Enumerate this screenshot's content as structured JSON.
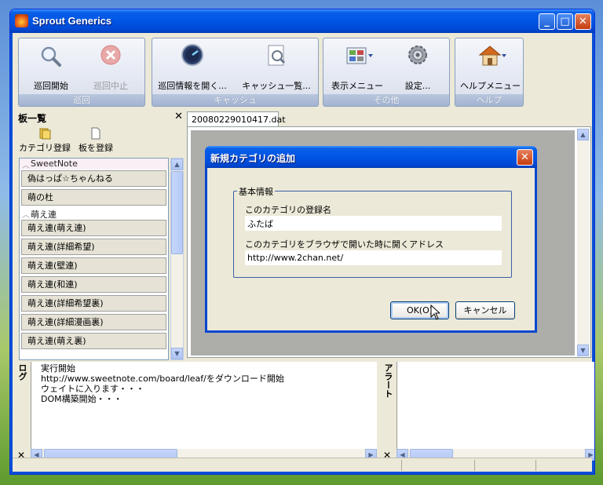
{
  "window": {
    "title": "Sprout Generics"
  },
  "ribbon": {
    "groups": [
      {
        "label": "巡回",
        "buttons": [
          {
            "label": "巡回開始",
            "icon": "magnifier-icon",
            "enabled": true
          },
          {
            "label": "巡回中止",
            "icon": "stop-icon",
            "enabled": false
          }
        ]
      },
      {
        "label": "キャッシュ",
        "buttons": [
          {
            "label": "巡回情報を開く...",
            "icon": "clock-icon"
          },
          {
            "label": "キャッシュ一覧...",
            "icon": "document-search-icon"
          }
        ]
      },
      {
        "label": "その他",
        "buttons": [
          {
            "label": "表示メニュー",
            "icon": "grid-icon"
          },
          {
            "label": "設定...",
            "icon": "gear-icon"
          }
        ]
      },
      {
        "label": "ヘルプ",
        "buttons": [
          {
            "label": "ヘルプメニュー",
            "icon": "house-icon"
          }
        ]
      }
    ]
  },
  "board_panel": {
    "title": "板一覧",
    "toolbar": {
      "add_category": "カテゴリ登録",
      "add_board": "板を登録"
    },
    "categories": [
      {
        "name": "SweetNote",
        "boards": [
          "偽はっぱ☆ちゃんねる",
          "萌の杜"
        ]
      },
      {
        "name": "萌え連",
        "boards": [
          "萌え連(萌え連)",
          "萌え連(詳細希望)",
          "萌え連(壁連)",
          "萌え連(和連)",
          "萌え連(詳細希望裏)",
          "萌え連(詳細漫画裏)",
          "萌え連(萌え裏)"
        ]
      }
    ]
  },
  "document": {
    "tab_label": "20080229010417.dat"
  },
  "dialog": {
    "title": "新規カテゴリの追加",
    "group_label": "基本情報",
    "name_label": "このカテゴリの登録名",
    "name_value": "ふたば",
    "address_label": "このカテゴリをブラウザで開いた時に開くアドレス",
    "address_value": "http://www.2chan.net/",
    "ok_label": "OK(O)",
    "cancel_label": "キャンセル"
  },
  "log_pane": {
    "title": "ログ",
    "lines": [
      "実行開始",
      "http://www.sweetnote.com/board/leaf/をダウンロード開始",
      "ウェイトに入ります・・・",
      "DOM構築開始・・・"
    ]
  },
  "alert_pane": {
    "title": "アラート"
  },
  "colors": {
    "titlebar": "#0055e5",
    "window_bg": "#ece9d8",
    "dialog_border": "#0a46d0"
  }
}
